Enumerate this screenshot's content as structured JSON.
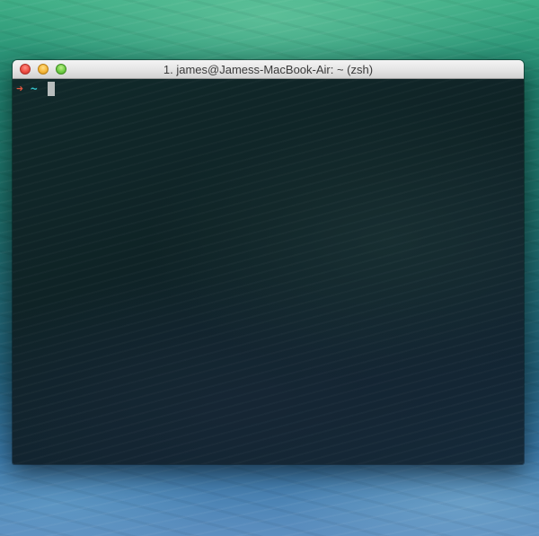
{
  "window": {
    "title": "1. james@Jamess-MacBook-Air: ~ (zsh)",
    "buttons": {
      "close_icon": "close-icon",
      "minimize_icon": "minimize-icon",
      "zoom_icon": "zoom-icon"
    }
  },
  "terminal": {
    "prompt_symbol": "➜",
    "prompt_dir": "~",
    "input_text": "",
    "colors": {
      "arrow": "#e0563f",
      "dir": "#35c2c9",
      "cursor": "#b8bdbd"
    }
  }
}
